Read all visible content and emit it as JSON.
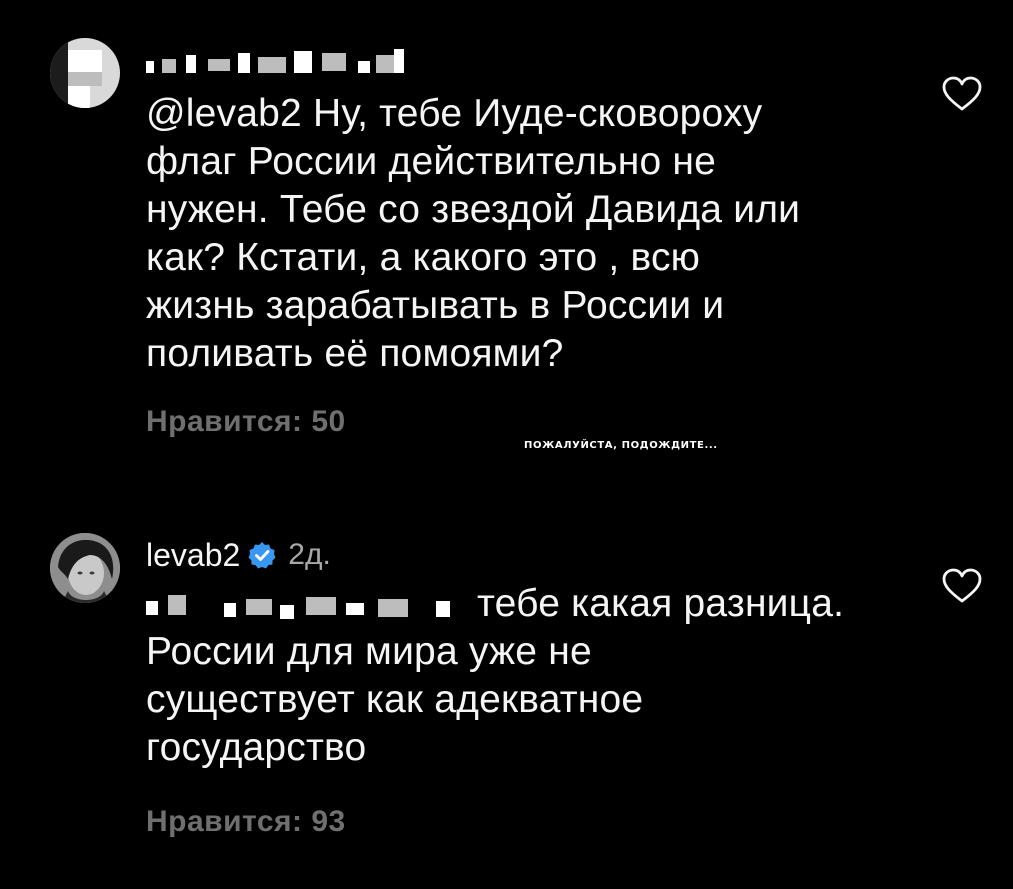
{
  "comments": [
    {
      "username_redacted": true,
      "time": "2д",
      "text_lines": [
        "@levab2 Ну, тебе Иуде-сковороху",
        "флаг России действительно не",
        "нужен.  Тебе со звездой Давида или",
        "как? Кстати, а какого это , всю",
        "жизнь зарабатывать в России и",
        "поливать её помоями?"
      ],
      "likes": "Нравится: 50",
      "heart_icon": "heart-outline-icon"
    },
    {
      "username": "levab2",
      "verified_icon": "verified-badge-icon",
      "verified_color": "#3897f0",
      "time": "2д.",
      "first_line_rest": "тебе какая разница.",
      "text_lines": [
        "России для мира уже не",
        "существует как адекватное",
        "государство"
      ],
      "likes": "Нравится: 93",
      "heart_icon": "heart-outline-icon"
    }
  ],
  "overlay": {
    "loading_text": "ПОЖАЛУЙСТА, ПОДОЖДИТЕ..."
  },
  "colors": {
    "background": "#000000",
    "text": "#f5f5f5",
    "muted": "#6f6f6f",
    "time": "#a8a8a8"
  }
}
